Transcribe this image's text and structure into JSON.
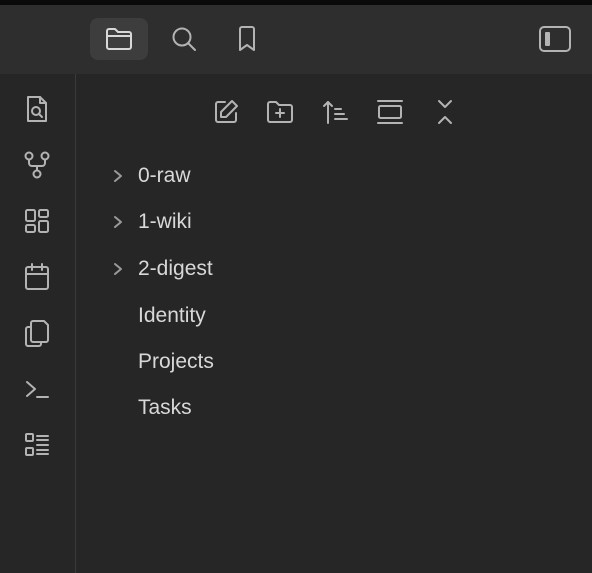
{
  "titlebar": {
    "icons": [
      "folder-icon",
      "search-icon",
      "bookmark-icon",
      "sidebar-toggle-icon"
    ]
  },
  "ribbon": {
    "icons": [
      "file-search-icon",
      "graph-icon",
      "grid-icon",
      "calendar-icon",
      "copy-icon",
      "terminal-icon",
      "list-icon"
    ]
  },
  "toolbar": {
    "icons": [
      "new-note-icon",
      "new-folder-icon",
      "sort-icon",
      "view-icon",
      "collapse-icon"
    ]
  },
  "tree": {
    "items": [
      {
        "label": "0-raw",
        "folder": true
      },
      {
        "label": "1-wiki",
        "folder": true
      },
      {
        "label": "2-digest",
        "folder": true
      },
      {
        "label": "Identity",
        "folder": false
      },
      {
        "label": "Projects",
        "folder": false
      },
      {
        "label": "Tasks",
        "folder": false
      }
    ]
  },
  "colors": {
    "background": "#262626",
    "titlebar": "#2e2e2e",
    "active_tab": "#3d3d3d",
    "text": "#d8d8d8"
  }
}
